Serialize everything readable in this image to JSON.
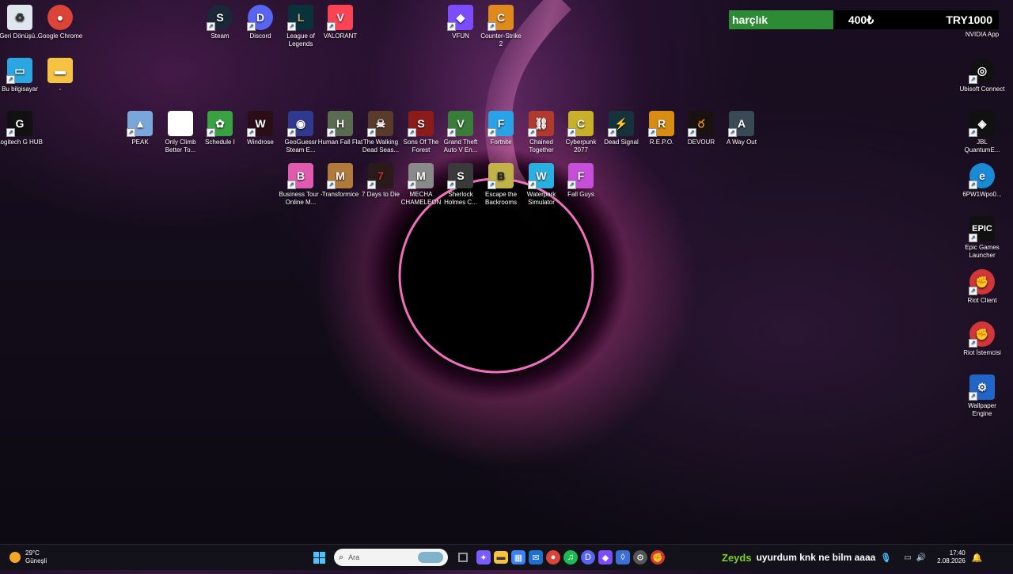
{
  "widget": {
    "name": "harçlık",
    "amount": "400₺",
    "currency": "TRY1000",
    "app_label": "NVIDIA App"
  },
  "desktop_icons": [
    {
      "label": "Geri Dönüşü...",
      "icon": "recycle-bin-icon",
      "color": "#dfe6ee",
      "glyph": "♻"
    },
    {
      "label": "Google Chrome",
      "icon": "chrome-icon",
      "color": "#db4437",
      "glyph": "●"
    },
    {
      "label": "Steam",
      "icon": "steam-icon",
      "color": "#1b2838",
      "glyph": "S"
    },
    {
      "label": "Discord",
      "icon": "discord-icon",
      "color": "#5865f2",
      "glyph": "D"
    },
    {
      "label": "League of Legends",
      "icon": "league-icon",
      "color": "#0a323c",
      "glyph": "L"
    },
    {
      "label": "VALORANT",
      "icon": "valorant-icon",
      "color": "#fa4454",
      "glyph": "V"
    },
    {
      "label": "VFUN",
      "icon": "vfun-icon",
      "color": "#7b4dff",
      "glyph": "◆"
    },
    {
      "label": "Counter-Strike 2",
      "icon": "cs2-icon",
      "color": "#e08a1e",
      "glyph": "C"
    },
    {
      "label": "Bu bilgisayar",
      "icon": "computer-icon",
      "color": "#2aa7e0",
      "glyph": "▭"
    },
    {
      "label": "-",
      "icon": "folder-icon",
      "color": "#f5c242",
      "glyph": "▬"
    },
    {
      "label": "Logitech G HUB",
      "icon": "logitech-icon",
      "color": "#111111",
      "glyph": "G"
    },
    {
      "label": "PEAK",
      "icon": "peak-icon",
      "color": "#7aa7d9",
      "glyph": "▲"
    },
    {
      "label": "Only Climb Better To...",
      "icon": "file-icon",
      "color": "#ffffff",
      "glyph": ""
    },
    {
      "label": "Schedule I",
      "icon": "schedule-icon",
      "color": "#3aa142",
      "glyph": "✿"
    },
    {
      "label": "Windrose",
      "icon": "windrose-icon",
      "color": "#2a0d16",
      "glyph": "W"
    },
    {
      "label": "GeoGuessr Steam E...",
      "icon": "geoguessr-icon",
      "color": "#2f3a8f",
      "glyph": "◉"
    },
    {
      "label": "Human Fall Flat",
      "icon": "hff-icon",
      "color": "#5b6b52",
      "glyph": "H"
    },
    {
      "label": "The Walking Dead Seas...",
      "icon": "twd-icon",
      "color": "#5a3a2a",
      "glyph": "☠"
    },
    {
      "label": "Sons Of The Forest",
      "icon": "sotf-icon",
      "color": "#8c1c1c",
      "glyph": "S"
    },
    {
      "label": "Grand Theft Auto V En...",
      "icon": "gta-icon",
      "color": "#3a7d3a",
      "glyph": "V"
    },
    {
      "label": "Fortnite",
      "icon": "fortnite-icon",
      "color": "#2aa3e6",
      "glyph": "F"
    },
    {
      "label": "Chained Together",
      "icon": "chained-icon",
      "color": "#b03a2e",
      "glyph": "⛓"
    },
    {
      "label": "Cyberpunk 2077",
      "icon": "cyberpunk-icon",
      "color": "#c8b02a",
      "glyph": "C"
    },
    {
      "label": "Dead Signal",
      "icon": "deadsignal-icon",
      "color": "#16323c",
      "glyph": "⚡"
    },
    {
      "label": "R.E.P.O.",
      "icon": "repo-icon",
      "color": "#d98c12",
      "glyph": "R"
    },
    {
      "label": "DEVOUR",
      "icon": "devour-icon",
      "color": "#1a1111",
      "glyph": "ర"
    },
    {
      "label": "A Way Out",
      "icon": "awayout-icon",
      "color": "#3a4a55",
      "glyph": "A"
    },
    {
      "label": "Business Tour - Online M...",
      "icon": "business-icon",
      "color": "#e05ab0",
      "glyph": "B"
    },
    {
      "label": "Transformice",
      "icon": "transformice-icon",
      "color": "#b07a3a",
      "glyph": "🐭"
    },
    {
      "label": "7 Days to Die",
      "icon": "7days-icon",
      "color": "#2a1a1a",
      "glyph": "7"
    },
    {
      "label": "MECHA CHAMELEON",
      "icon": "mecha-icon",
      "color": "#8a8a8a",
      "glyph": "M"
    },
    {
      "label": "Sherlock Holmes C...",
      "icon": "sherlock-icon",
      "color": "#3a3a3a",
      "glyph": "S"
    },
    {
      "label": "Escape the Backrooms",
      "icon": "backrooms-icon",
      "color": "#c2b24a",
      "glyph": "B"
    },
    {
      "label": "Waterpark Simulator",
      "icon": "waterpark-icon",
      "color": "#2ab0e0",
      "glyph": "W"
    },
    {
      "label": "Fall Guys",
      "icon": "fallguys-icon",
      "color": "#c64fd9",
      "glyph": "F"
    },
    {
      "label": "Ubisoft Connect",
      "icon": "ubisoft-icon",
      "color": "#111111",
      "glyph": "◎"
    },
    {
      "label": "JBL QuantumE...",
      "icon": "jbl-icon",
      "color": "#111111",
      "glyph": "◈"
    },
    {
      "label": "6PW1Wpo0...",
      "icon": "edge-icon",
      "color": "#1a8ad4",
      "glyph": "e"
    },
    {
      "label": "Epic Games Launcher",
      "icon": "epic-icon",
      "color": "#111111",
      "glyph": "E"
    },
    {
      "label": "Riot Client",
      "icon": "riot-icon",
      "color": "#d13639",
      "glyph": "✊"
    },
    {
      "label": "Riot İstemcisi",
      "icon": "riot-client-icon",
      "color": "#d13639",
      "glyph": "✊"
    },
    {
      "label": "Wallpaper Engine",
      "icon": "wallpaper-engine-icon",
      "color": "#1f66c8",
      "glyph": "⚙"
    }
  ],
  "taskbar": {
    "weather": {
      "temp": "29°C",
      "desc": "Güneşli"
    },
    "search_placeholder": "Ara",
    "apps": [
      {
        "icon": "task-view-icon",
        "color": "#666666",
        "glyph": "▢"
      },
      {
        "icon": "copilot-icon",
        "color": "#7b5cff",
        "glyph": "✦"
      },
      {
        "icon": "file-explorer-icon",
        "color": "#f5c242",
        "glyph": "▬"
      },
      {
        "icon": "store-icon",
        "color": "#3b82f6",
        "glyph": "▦"
      },
      {
        "icon": "outlook-icon",
        "color": "#1f6fd1",
        "glyph": "✉"
      },
      {
        "icon": "chrome-icon",
        "color": "#db4437",
        "glyph": "●"
      },
      {
        "icon": "spotify-icon",
        "color": "#1db954",
        "glyph": "♫"
      },
      {
        "icon": "discord-icon",
        "color": "#5865f2",
        "glyph": "D"
      },
      {
        "icon": "vfun-icon",
        "color": "#7b4dff",
        "glyph": "◆"
      },
      {
        "icon": "app-icon",
        "color": "#3b6fd1",
        "glyph": "◊"
      },
      {
        "icon": "settings-icon",
        "color": "#555555",
        "glyph": "⚙"
      },
      {
        "icon": "riot-icon",
        "color": "#d13639",
        "glyph": "✊"
      }
    ],
    "now_playing_user": "Zeyds",
    "now_playing_text": "uyurdum knk ne bilm aaaa",
    "time": "17:40",
    "date": "2.08.2026"
  }
}
